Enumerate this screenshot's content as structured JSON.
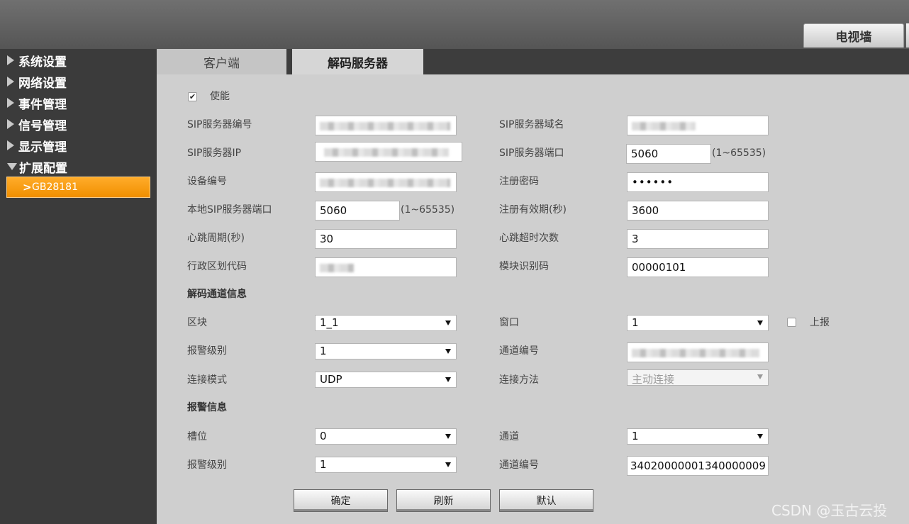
{
  "header": {
    "tv_wall_tab": "电视墙"
  },
  "sidebar": {
    "items": [
      {
        "label": "系统设置",
        "expanded": false
      },
      {
        "label": "网络设置",
        "expanded": false
      },
      {
        "label": "事件管理",
        "expanded": false
      },
      {
        "label": "信号管理",
        "expanded": false
      },
      {
        "label": "显示管理",
        "expanded": false
      },
      {
        "label": "扩展配置",
        "expanded": true
      }
    ],
    "sub_item": {
      "label": "GB28181",
      "selected": true
    }
  },
  "tabs": [
    {
      "label": "客户端",
      "active": false
    },
    {
      "label": "解码服务器",
      "active": true
    }
  ],
  "form": {
    "enable": {
      "label": "使能",
      "checked": true
    },
    "sip_server_id": {
      "label": "SIP服务器编号"
    },
    "sip_server_domain": {
      "label": "SIP服务器域名"
    },
    "sip_server_ip": {
      "label": "SIP服务器IP"
    },
    "sip_server_port": {
      "label": "SIP服务器端口",
      "value": "5060",
      "range": "(1~65535)"
    },
    "device_id": {
      "label": "设备编号"
    },
    "register_password": {
      "label": "注册密码",
      "value": "••••••"
    },
    "local_sip_port": {
      "label": "本地SIP服务器端口",
      "value": "5060",
      "range": "(1~65535)"
    },
    "register_validity": {
      "label": "注册有效期(秒)",
      "value": "3600"
    },
    "heartbeat_period": {
      "label": "心跳周期(秒)",
      "value": "30"
    },
    "heartbeat_timeout_count": {
      "label": "心跳超时次数",
      "value": "3"
    },
    "admin_region_code": {
      "label": "行政区划代码"
    },
    "module_id_code": {
      "label": "模块识别码",
      "value": "00000101"
    },
    "decode_channel_section": "解码通道信息",
    "block": {
      "label": "区块",
      "value": "1_1"
    },
    "window": {
      "label": "窗口",
      "value": "1"
    },
    "report": {
      "label": "上报",
      "checked": false
    },
    "alarm_level_1": {
      "label": "报警级别",
      "value": "1"
    },
    "channel_id_1": {
      "label": "通道编号"
    },
    "connect_mode": {
      "label": "连接模式",
      "value": "UDP"
    },
    "connect_method": {
      "label": "连接方法",
      "value": "主动连接",
      "disabled": true
    },
    "alarm_section": "报警信息",
    "slot": {
      "label": "槽位",
      "value": "0"
    },
    "channel": {
      "label": "通道",
      "value": "1"
    },
    "alarm_level_2": {
      "label": "报警级别",
      "value": "1"
    },
    "channel_id_2": {
      "label": "通道编号",
      "value": "34020000001340000009"
    }
  },
  "buttons": {
    "ok": "确定",
    "refresh": "刷新",
    "default": "默认"
  },
  "watermark": "CSDN @玉古云投"
}
